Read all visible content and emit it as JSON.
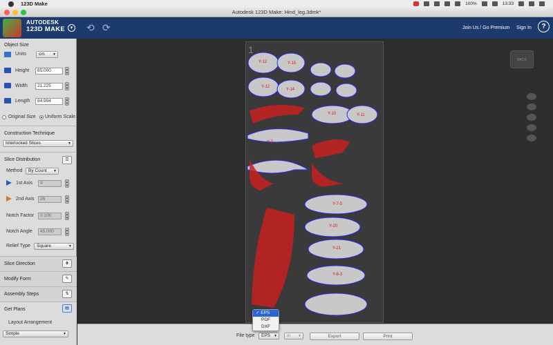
{
  "menubar": {
    "app_name": "123D Make",
    "battery": "100%",
    "clock": "13:33"
  },
  "window": {
    "title": "Autodesk 123D Make: Hind_leg.3dmk*"
  },
  "header": {
    "brand_line1": "AUTODESK",
    "brand_line2": "123D MAKE",
    "join_label": "Join Us / Go Premium",
    "signin_label": "Sign In",
    "help_label": "?"
  },
  "object_size": {
    "title": "Object Size",
    "units_label": "Units",
    "units_value": "cm",
    "height_label": "Height",
    "height_value": "65.000",
    "width_label": "Width",
    "width_value": "21.225",
    "length_label": "Length",
    "length_value": "84.994",
    "original_size_label": "Original Size",
    "uniform_scale_label": "Uniform Scale"
  },
  "construction": {
    "title": "Construction Technique",
    "value": "Interlocked Slices"
  },
  "slice_distribution": {
    "title": "Slice Distribution",
    "method_label": "Method",
    "method_value": "By Count",
    "axis1_label": "1st Axis",
    "axis1_value": "9",
    "axis2_label": "2nd Axis",
    "axis2_value": "26",
    "notch_factor_label": "Notch Factor",
    "notch_factor_value": "0.100",
    "notch_angle_label": "Notch Angle",
    "notch_angle_value": "45.000",
    "relief_label": "Relief Type",
    "relief_value": "Square"
  },
  "sections": {
    "slice_direction": "Slice Direction",
    "modify_form": "Modify Form",
    "assembly_steps": "Assembly Steps",
    "get_plans": "Get Plans",
    "layout_arrangement_label": "Layout Arrangement",
    "layout_value": "Simple"
  },
  "canvas": {
    "sheet_number": "1"
  },
  "bottom": {
    "filetype_label": "File type",
    "filetype_value": "EPS",
    "units_value": "in",
    "export_label": "Export",
    "print_label": "Print"
  },
  "filetype_menu": {
    "options": [
      "EPS",
      "PDF",
      "DXF"
    ],
    "selected": "EPS"
  },
  "colors": {
    "header": "#1c3a6e",
    "outline": "#2a2af0",
    "label_red": "#e01010",
    "part_fill": "#c8c8c8"
  }
}
